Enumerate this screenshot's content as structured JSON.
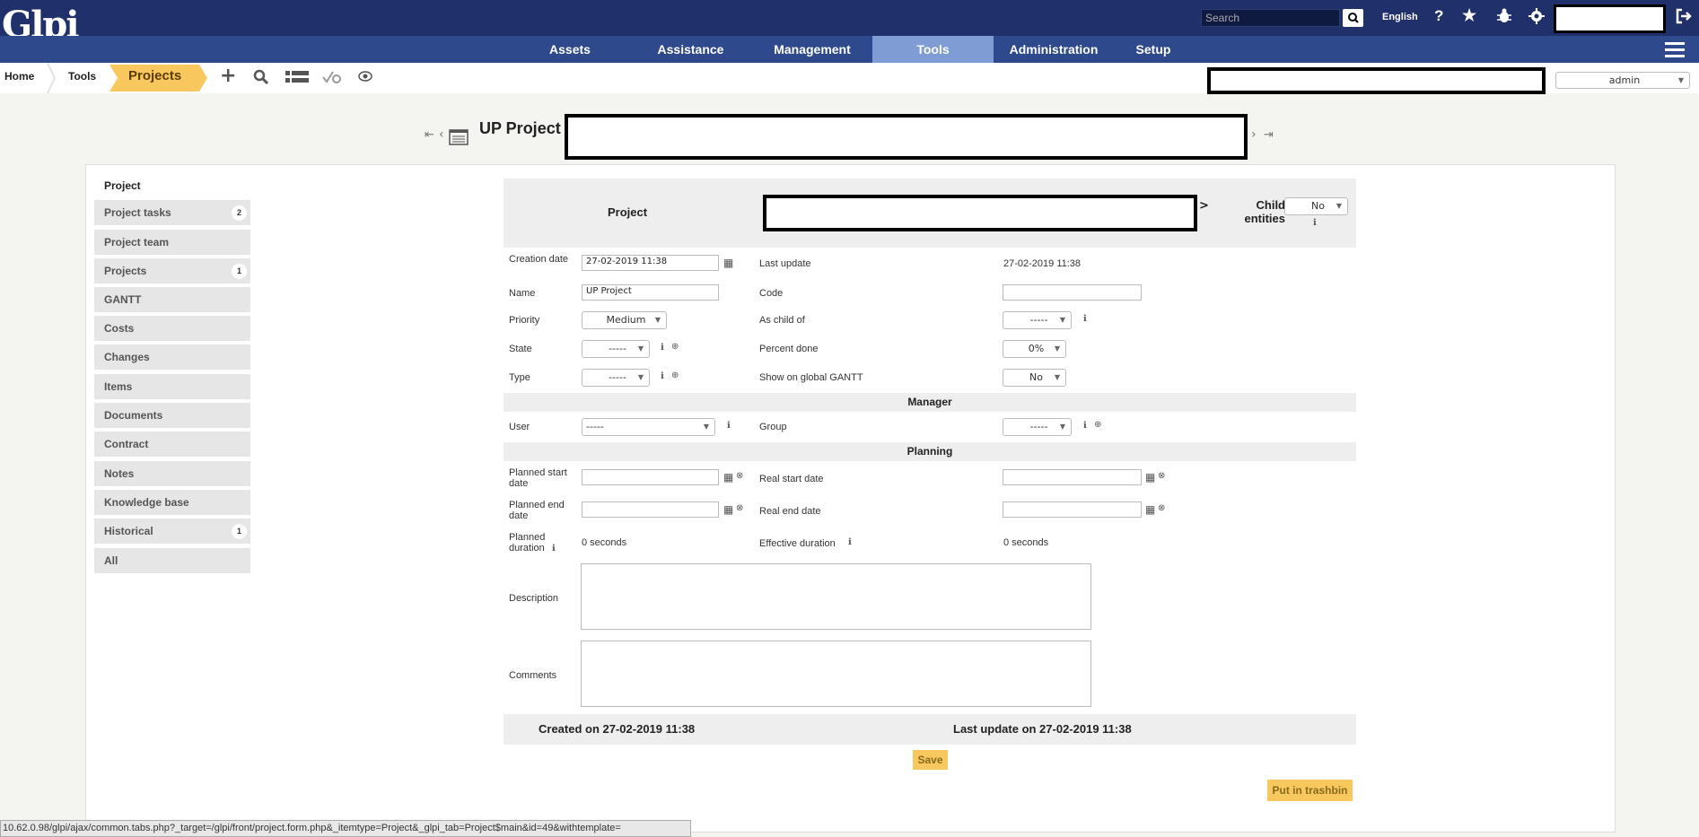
{
  "app": {
    "logo": "Glpi"
  },
  "topbar": {
    "search_placeholder": "Search",
    "language": "English",
    "help_glyph": "?",
    "icons": [
      "search-icon",
      "help-icon",
      "star-icon",
      "bug-icon",
      "gear-icon",
      "logout-icon",
      "hamburger-icon"
    ]
  },
  "menu": {
    "items": [
      {
        "label": "Assets"
      },
      {
        "label": "Assistance"
      },
      {
        "label": "Management"
      },
      {
        "label": "Tools"
      },
      {
        "label": "Administration"
      },
      {
        "label": "Setup"
      }
    ],
    "active": "Tools"
  },
  "breadcrumb": {
    "home": "Home",
    "tools": "Tools",
    "projects": "Projects"
  },
  "user": {
    "profile": "admin"
  },
  "page": {
    "title": "UP Project"
  },
  "tabs": [
    {
      "label": "Project",
      "count": ""
    },
    {
      "label": "Project tasks",
      "count": "2"
    },
    {
      "label": "Project team",
      "count": ""
    },
    {
      "label": "Projects",
      "count": "1"
    },
    {
      "label": "GANTT",
      "count": ""
    },
    {
      "label": "Costs",
      "count": ""
    },
    {
      "label": "Changes",
      "count": ""
    },
    {
      "label": "Items",
      "count": ""
    },
    {
      "label": "Documents",
      "count": ""
    },
    {
      "label": "Contract",
      "count": ""
    },
    {
      "label": "Notes",
      "count": ""
    },
    {
      "label": "Knowledge base",
      "count": ""
    },
    {
      "label": "Historical",
      "count": "1"
    },
    {
      "label": "All",
      "count": ""
    }
  ],
  "form": {
    "header_label": "Project",
    "arrow": ">",
    "child_entities_label": "Child entities",
    "child_entities_value": "No",
    "creation_date_label": "Creation date",
    "creation_date_value": "27-02-2019 11:38",
    "last_update_label": "Last update",
    "last_update_value": "27-02-2019 11:38",
    "name_label": "Name",
    "name_value": "UP Project",
    "code_label": "Code",
    "code_value": "",
    "priority_label": "Priority",
    "priority_value": "Medium",
    "as_child_of_label": "As child of",
    "as_child_of_value": "-----",
    "state_label": "State",
    "state_value": "-----",
    "percent_done_label": "Percent done",
    "percent_done_value": "0%",
    "type_label": "Type",
    "type_value": "-----",
    "show_gantt_label": "Show on global GANTT",
    "show_gantt_value": "No",
    "manager_section": "Manager",
    "user_label": "User",
    "user_value": "-----",
    "group_label": "Group",
    "group_value": "-----",
    "planning_section": "Planning",
    "planned_start_label": "Planned start date",
    "real_start_label": "Real start date",
    "planned_end_label": "Planned end date",
    "real_end_label": "Real end date",
    "planned_duration_label": "Planned duration",
    "planned_duration_value": "0 seconds",
    "effective_duration_label": "Effective duration",
    "effective_duration_value": "0 seconds",
    "description_label": "Description",
    "comments_label": "Comments",
    "created_on": "Created on 27-02-2019 11:38",
    "last_update_on": "Last update on 27-02-2019 11:38",
    "save_label": "Save",
    "trash_label": "Put in trashbin"
  },
  "statusbar": {
    "url": "10.62.0.98/glpi/ajax/common.tabs.php?_target=/glpi/front/project.form.php&_itemtype=Project&_glpi_tab=Project$main&id=49&withtemplate="
  }
}
